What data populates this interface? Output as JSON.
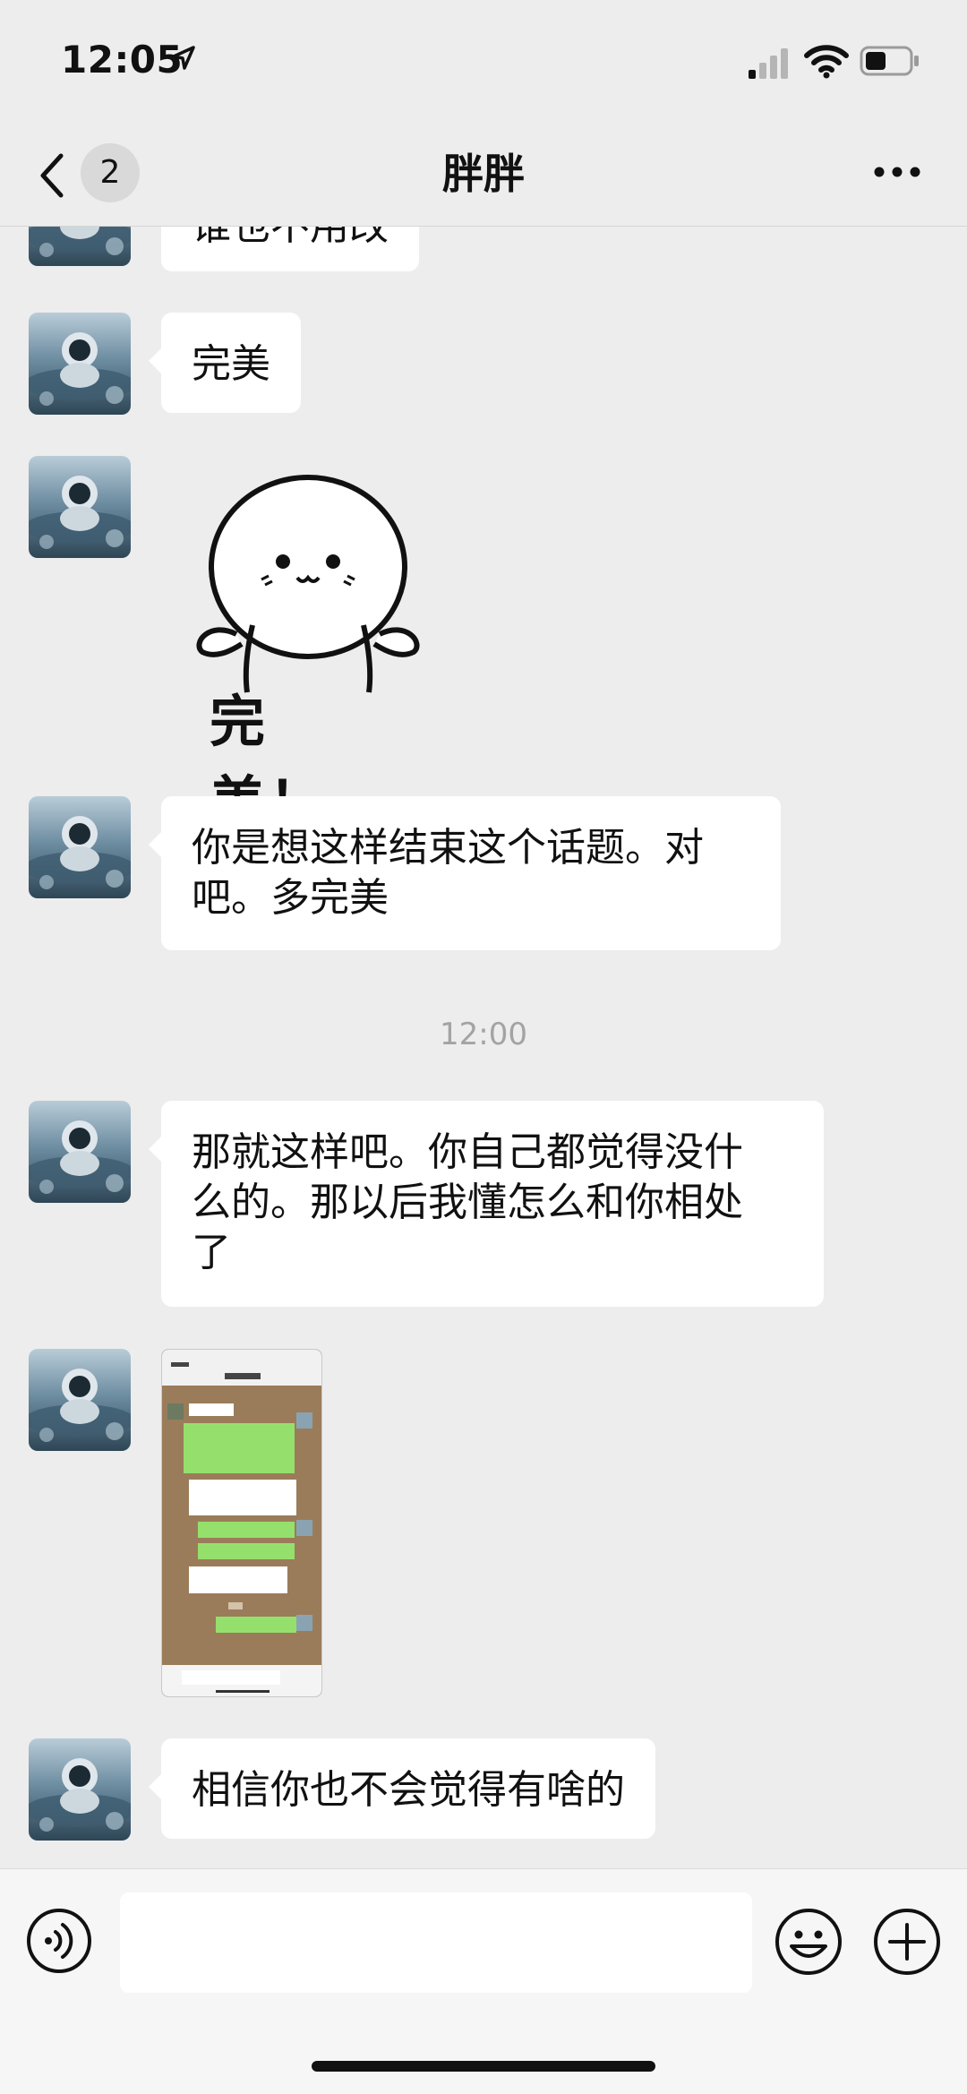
{
  "status_bar": {
    "time": "12:05",
    "signal_icon": "signal-icon",
    "wifi_icon": "wifi-icon",
    "battery_icon": "battery-icon"
  },
  "nav": {
    "unread_count": "2",
    "title": "胖胖",
    "back_icon": "chevron-left-icon",
    "more_icon": "more-dots-icon"
  },
  "messages": [
    {
      "type": "text",
      "text": "谁也不用改"
    },
    {
      "type": "text",
      "text": "完美"
    },
    {
      "type": "sticker",
      "caption": "完　美！"
    },
    {
      "type": "text",
      "line1": "你是想这样结束这个话题。对",
      "line2": "吧。多完美"
    },
    {
      "type": "timestamp",
      "text": "12:00"
    },
    {
      "type": "text",
      "line1": "那就这样吧。你自己都觉得没什",
      "line2": "么的。那以后我懂怎么和你相处",
      "line3": "了"
    },
    {
      "type": "image"
    },
    {
      "type": "text",
      "text": "相信你也不会觉得有啥的"
    }
  ],
  "input_bar": {
    "voice_icon": "voice-icon",
    "emoji_icon": "emoji-icon",
    "plus_icon": "plus-icon",
    "input_value": ""
  },
  "colors": {
    "background": "#ededed",
    "bubble": "#ffffff",
    "timestamp": "#a3a3a3"
  }
}
